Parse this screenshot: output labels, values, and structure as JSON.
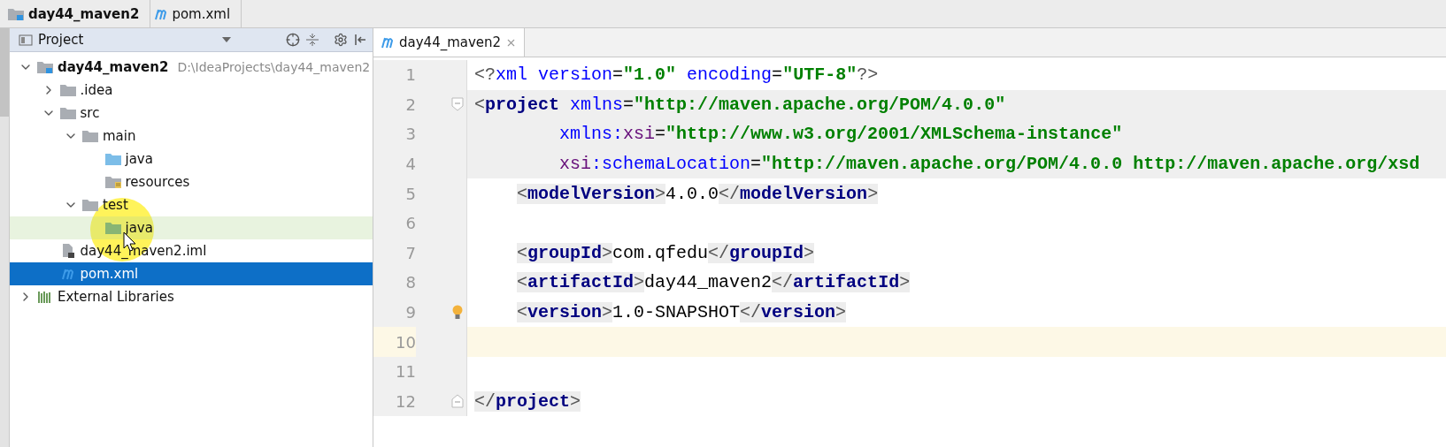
{
  "breadcrumbs": [
    {
      "label": "day44_maven2",
      "kind": "module"
    },
    {
      "label": "pom.xml",
      "kind": "maven"
    }
  ],
  "project_panel": {
    "title": "Project",
    "tree": [
      {
        "label": "day44_maven2",
        "kind": "module",
        "hint": "D:\\IdeaProjects\\day44_maven2",
        "expanded": true,
        "selected": false,
        "hovered": false,
        "children": [
          {
            "label": ".idea",
            "kind": "folder",
            "expanded": false,
            "selected": false,
            "hovered": false
          },
          {
            "label": "src",
            "kind": "folder",
            "expanded": true,
            "selected": false,
            "hovered": false,
            "children": [
              {
                "label": "main",
                "kind": "folder",
                "expanded": true,
                "selected": false,
                "hovered": false,
                "children": [
                  {
                    "label": "java",
                    "kind": "source",
                    "selected": false,
                    "hovered": false
                  },
                  {
                    "label": "resources",
                    "kind": "resources",
                    "selected": false,
                    "hovered": false
                  }
                ]
              },
              {
                "label": "test",
                "kind": "folder",
                "expanded": true,
                "selected": false,
                "hovered": false,
                "children": [
                  {
                    "label": "java",
                    "kind": "test",
                    "selected": false,
                    "hovered": true
                  }
                ]
              }
            ]
          },
          {
            "label": "day44_maven2.iml",
            "kind": "iml",
            "selected": false,
            "hovered": false
          },
          {
            "label": "pom.xml",
            "kind": "maven",
            "selected": true,
            "hovered": false
          }
        ]
      },
      {
        "label": "External Libraries",
        "kind": "libraries",
        "expanded": false,
        "selected": false,
        "hovered": false
      }
    ]
  },
  "editor": {
    "tabs": [
      {
        "label": "day44_maven2",
        "kind": "maven",
        "selected": true
      }
    ],
    "lines": [
      {
        "number": "1",
        "kind": "root",
        "highlighted": false,
        "current": false,
        "tokens": [
          {
            "t": "<?",
            "kind": "punct"
          },
          {
            "t": "xml ",
            "kind": "attr"
          },
          {
            "t": "version",
            "kind": "attr"
          },
          {
            "t": "=",
            "kind": "text"
          },
          {
            "t": "\"1.0\"",
            "kind": "str"
          },
          {
            "t": " encoding",
            "kind": "attr"
          },
          {
            "t": "=",
            "kind": "text"
          },
          {
            "t": "\"UTF-8\"",
            "kind": "str"
          },
          {
            "t": "?>",
            "kind": "punct"
          }
        ]
      },
      {
        "number": "2",
        "kind": "root",
        "highlighted": true,
        "current": false,
        "gutter": {
          "kind": "fold"
        },
        "tokens": [
          {
            "t": "<",
            "kind": "punct"
          },
          {
            "t": "project",
            "kind": "tag"
          },
          {
            "t": " xmlns",
            "kind": "attr"
          },
          {
            "t": "=",
            "kind": "text"
          },
          {
            "t": "\"http://maven.apache.org/POM/4.0.0\"",
            "kind": "str"
          }
        ]
      },
      {
        "number": "3",
        "kind": "attribute",
        "highlighted": true,
        "current": false,
        "tokens": [
          {
            "t": "xmlns:",
            "kind": "attr"
          },
          {
            "t": "xsi",
            "kind": "ns"
          },
          {
            "t": "=",
            "kind": "text"
          },
          {
            "t": "\"http://www.w3.org/2001/XMLSchema-instance\"",
            "kind": "str"
          }
        ]
      },
      {
        "number": "4",
        "kind": "attribute",
        "highlighted": true,
        "current": false,
        "tokens": [
          {
            "t": "xsi",
            "kind": "ns"
          },
          {
            "t": ":schemaLocation",
            "kind": "attr"
          },
          {
            "t": "=",
            "kind": "text"
          },
          {
            "t": "\"http://maven.apache.org/POM/4.0.0 http://maven.apache.org/xsd",
            "kind": "str"
          }
        ]
      },
      {
        "number": "5",
        "kind": "child",
        "highlighted": false,
        "current": false,
        "tokens": [
          {
            "t": "<",
            "kind": "punct",
            "shaded": true
          },
          {
            "t": "modelVersion",
            "kind": "tag",
            "shaded": true
          },
          {
            "t": ">",
            "kind": "punct",
            "shaded": true
          },
          {
            "t": "4.0.0",
            "kind": "text",
            "shaded": false
          },
          {
            "t": "</",
            "kind": "punct",
            "shaded": true
          },
          {
            "t": "modelVersion",
            "kind": "tag",
            "shaded": true
          },
          {
            "t": ">",
            "kind": "punct",
            "shaded": true
          }
        ]
      },
      {
        "number": "6",
        "kind": "root",
        "highlighted": false,
        "current": false
      },
      {
        "number": "7",
        "kind": "child",
        "highlighted": false,
        "current": false,
        "tokens": [
          {
            "t": "<",
            "kind": "punct",
            "shaded": true
          },
          {
            "t": "groupId",
            "kind": "tag",
            "shaded": true
          },
          {
            "t": ">",
            "kind": "punct",
            "shaded": true
          },
          {
            "t": "com.qfedu",
            "kind": "text",
            "shaded": false
          },
          {
            "t": "</",
            "kind": "punct",
            "shaded": true
          },
          {
            "t": "groupId",
            "kind": "tag",
            "shaded": true
          },
          {
            "t": ">",
            "kind": "punct",
            "shaded": true
          }
        ]
      },
      {
        "number": "8",
        "kind": "child",
        "highlighted": false,
        "current": false,
        "tokens": [
          {
            "t": "<",
            "kind": "punct",
            "shaded": true
          },
          {
            "t": "artifactId",
            "kind": "tag",
            "shaded": true
          },
          {
            "t": ">",
            "kind": "punct",
            "shaded": true
          },
          {
            "t": "day44_maven2",
            "kind": "text",
            "shaded": false
          },
          {
            "t": "</",
            "kind": "punct",
            "shaded": true
          },
          {
            "t": "artifactId",
            "kind": "tag",
            "shaded": true
          },
          {
            "t": ">",
            "kind": "punct",
            "shaded": true
          }
        ]
      },
      {
        "number": "9",
        "kind": "child",
        "highlighted": false,
        "current": false,
        "gutter": {
          "kind": "bulb"
        },
        "tokens": [
          {
            "t": "<",
            "kind": "punct",
            "shaded": true
          },
          {
            "t": "version",
            "kind": "tag",
            "shaded": true
          },
          {
            "t": ">",
            "kind": "punct",
            "shaded": true
          },
          {
            "t": "1.0-SNAPSHOT",
            "kind": "text",
            "shaded": false
          },
          {
            "t": "</",
            "kind": "punct",
            "shaded": true
          },
          {
            "t": "version",
            "kind": "tag",
            "shaded": true
          },
          {
            "t": ">",
            "kind": "punct",
            "shaded": true
          }
        ]
      },
      {
        "number": "10",
        "kind": "root",
        "highlighted": false,
        "current": true
      },
      {
        "number": "11",
        "kind": "root",
        "highlighted": false,
        "current": false
      },
      {
        "number": "12",
        "kind": "root",
        "highlighted": false,
        "current": false,
        "gutter": {
          "kind": "fold-end"
        },
        "tokens": [
          {
            "t": "</",
            "kind": "punct",
            "shaded": true
          },
          {
            "t": "project",
            "kind": "tag",
            "shaded": true
          },
          {
            "t": ">",
            "kind": "punct",
            "shaded": true
          }
        ]
      }
    ]
  }
}
